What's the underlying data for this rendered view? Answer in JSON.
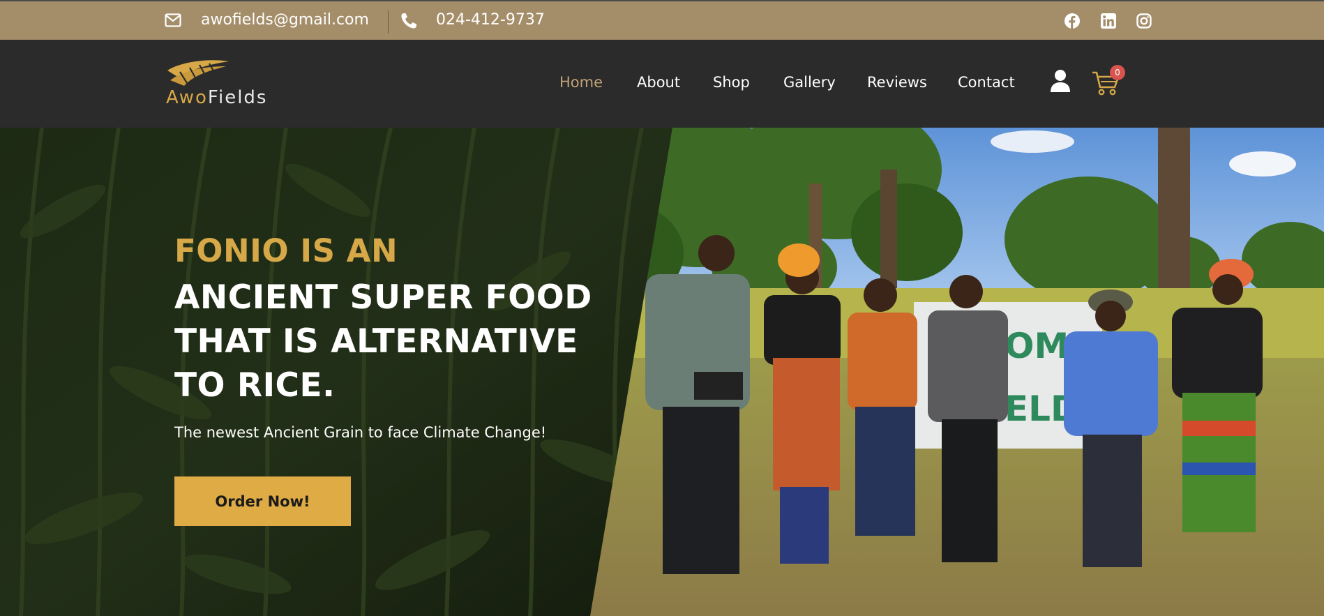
{
  "topbar": {
    "email": "awofields@gmail.com",
    "phone": "024-412-9737",
    "social_icons": [
      "facebook-icon",
      "linkedin-icon",
      "instagram-icon"
    ]
  },
  "brand": {
    "logo_part1": "Awo",
    "logo_part2": "Fields",
    "gold": "#d6a848",
    "topbar_color": "#a48d69",
    "header_color": "#2b2b2b"
  },
  "nav": {
    "items": [
      "Home",
      "About",
      "Shop",
      "Gallery",
      "Reviews",
      "Contact"
    ],
    "active": "Home",
    "cart_count": "0"
  },
  "hero": {
    "title_line1": "FONIO IS AN",
    "title_line2": "ANCIENT SUPER FOOD THAT IS ALTERNATIVE TO RICE.",
    "subtitle": "The newest Ancient Grain to face Climate Change!",
    "cta": "Order Now!",
    "banner_text": "OME",
    "banner_text2": "ELD"
  }
}
